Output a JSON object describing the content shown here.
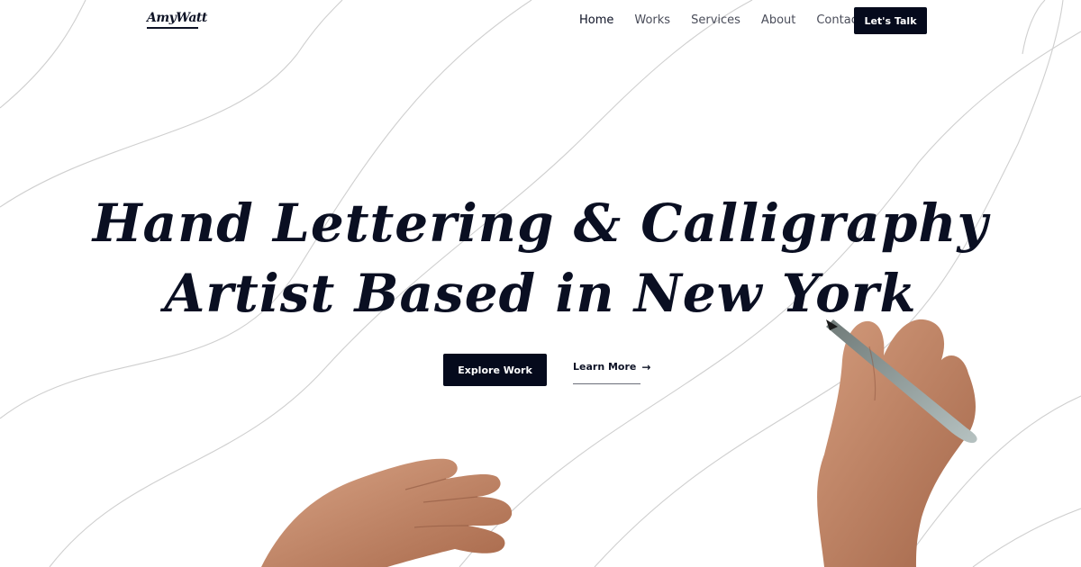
{
  "brand": {
    "logo_text": "AmyWatt"
  },
  "nav": {
    "items": [
      {
        "label": "Home",
        "active": true
      },
      {
        "label": "Works",
        "active": false
      },
      {
        "label": "Services",
        "active": false
      },
      {
        "label": "About",
        "active": false
      },
      {
        "label": "Contact",
        "active": false
      }
    ],
    "cta_label": "Let's Talk"
  },
  "hero": {
    "headline_line1": "Hand Lettering & Calligraphy",
    "headline_line2": "Artist Based in New York",
    "primary_button": "Explore Work",
    "secondary_link": "Learn More",
    "secondary_icon": "arrow-right-icon"
  },
  "colors": {
    "ink": "#0a0f22",
    "button_bg": "#050a1c",
    "background": "#ffffff",
    "line": "#cfcfcf"
  }
}
